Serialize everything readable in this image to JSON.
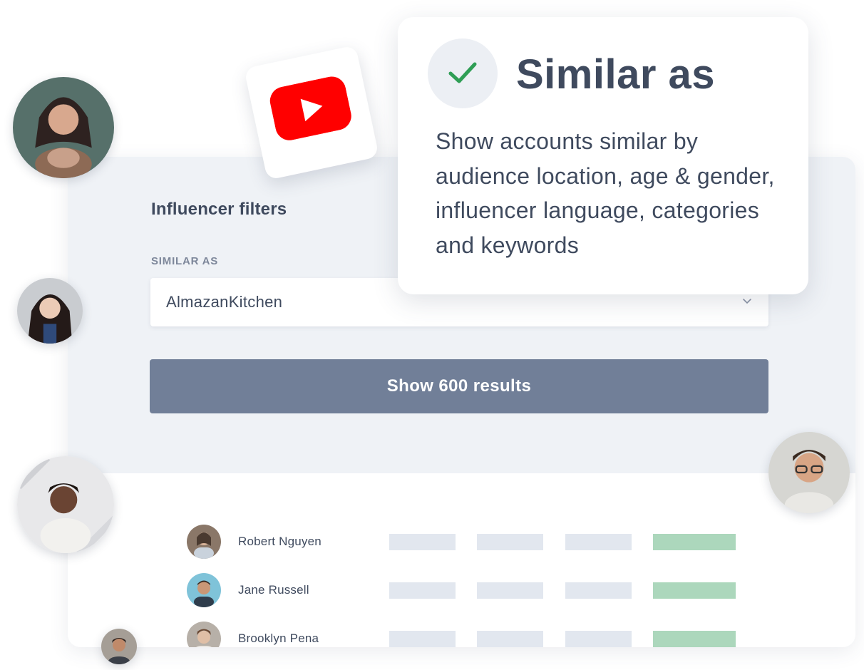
{
  "filters": {
    "title": "Influencer filters",
    "similar_label": "SIMILAR AS",
    "similar_value": "AlmazanKitchen",
    "show_button_label": "Show 600 results"
  },
  "tooltip": {
    "title": "Similar as",
    "description": "Show accounts similar by audience location, age & gender, influencer language, categories and keywords"
  },
  "platform_icon": "youtube-icon",
  "results": [
    {
      "name": "Robert Nguyen"
    },
    {
      "name": "Jane Russell"
    },
    {
      "name": "Brooklyn Pena"
    }
  ],
  "colors": {
    "panel_background": "#eff2f6",
    "button": "#717f98",
    "check": "#2f9e55",
    "youtube_red": "#ff0000",
    "placeholder_bar": "#e2e7ef",
    "highlight_bar": "#acd7bc",
    "text": "#3f4a5e"
  }
}
